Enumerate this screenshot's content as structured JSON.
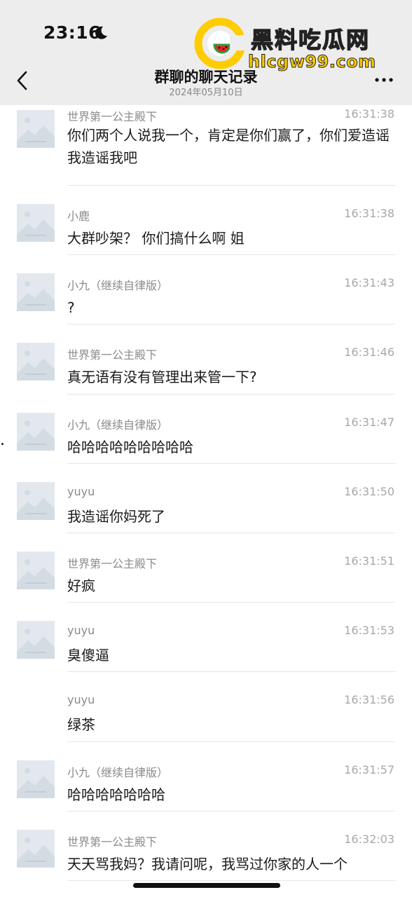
{
  "status_bar": {
    "time": "23:16"
  },
  "nav": {
    "title": "群聊的聊天记录",
    "subtitle": "2024年05月10日"
  },
  "watermark": {
    "name": "黑料吃瓜网",
    "url": "hlcgw99.com"
  },
  "messages": [
    {
      "sender": "世界第一公主殿下",
      "time": "16:31:38",
      "text": "你们两个人说我一个，肯定是你们赢了，你们爱造谣我造谣我吧",
      "avatar": true
    },
    {
      "sender": "小鹿",
      "time": "16:31:38",
      "text": "大群吵架？ 你们搞什么啊 姐",
      "avatar": true
    },
    {
      "sender": "小九（继续自律版）",
      "time": "16:31:43",
      "text": "?",
      "avatar": true
    },
    {
      "sender": "世界第一公主殿下",
      "time": "16:31:46",
      "text": "真无语有没有管理出来管一下?",
      "avatar": true
    },
    {
      "sender": "小九（继续自律版）",
      "time": "16:31:47",
      "text": "哈哈哈哈哈哈哈哈哈",
      "avatar": true
    },
    {
      "sender": "yuyu",
      "time": "16:31:50",
      "text": "我造谣你妈死了",
      "avatar": true
    },
    {
      "sender": "世界第一公主殿下",
      "time": "16:31:51",
      "text": "好疯",
      "avatar": true
    },
    {
      "sender": "yuyu",
      "time": "16:31:53",
      "text": "臭傻逼",
      "avatar": true
    },
    {
      "sender": "yuyu",
      "time": "16:31:56",
      "text": "绿茶",
      "avatar": false
    },
    {
      "sender": "小九（继续自律版）",
      "time": "16:31:57",
      "text": "哈哈哈哈哈哈哈",
      "avatar": true
    },
    {
      "sender": "世界第一公主殿下",
      "time": "16:32:03",
      "text": "天天骂我妈？我请问呢，我骂过你家的人一个",
      "avatar": true
    }
  ]
}
